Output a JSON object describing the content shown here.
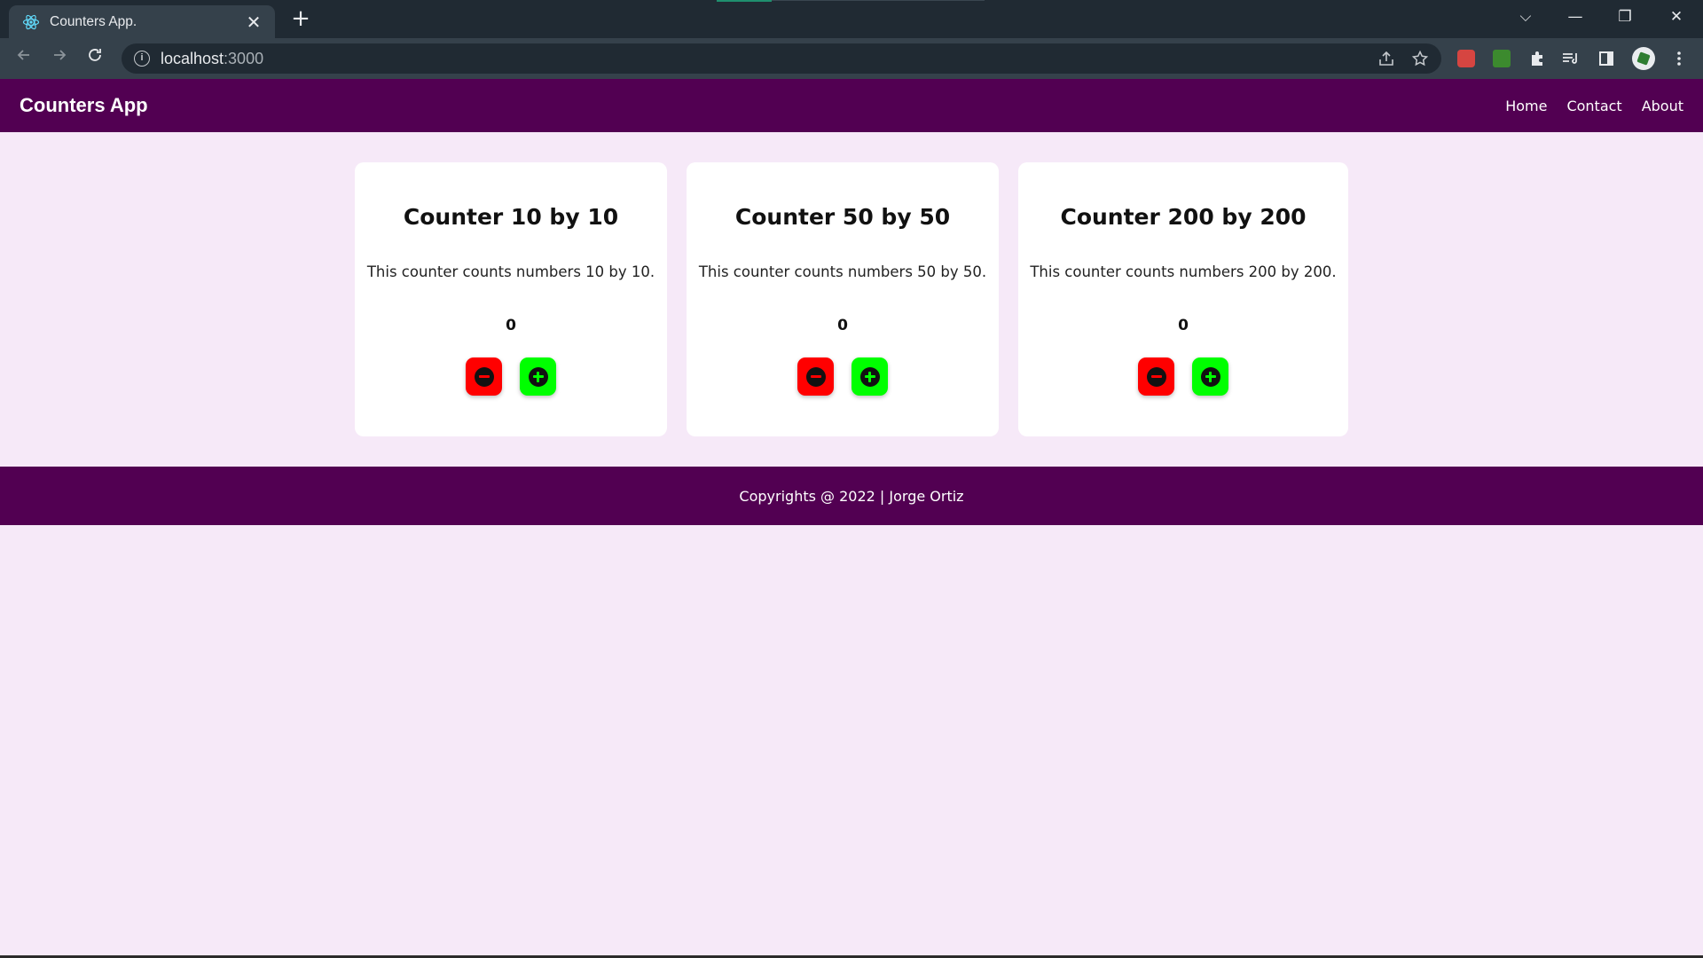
{
  "browser": {
    "tab_title": "Counters App.",
    "tab_close": "✕",
    "new_tab": "+",
    "url_host": "localhost",
    "url_port": ":3000",
    "window_controls": {
      "tab_search": "⌵",
      "minimize": "—",
      "restore": "❐",
      "close": "✕"
    },
    "icons": [
      "back-arrow-icon",
      "forward-arrow-icon",
      "reload-icon",
      "info-icon",
      "share-icon",
      "star-icon",
      "puzzle-icon",
      "media-icon",
      "side-panel-icon",
      "kebab-menu-icon"
    ]
  },
  "app": {
    "brand": "Counters App",
    "nav": {
      "home": "Home",
      "contact": "Contact",
      "about": "About"
    },
    "counters": [
      {
        "title": "Counter 10 by 10",
        "description": "This counter counts numbers 10 by 10.",
        "value": "0"
      },
      {
        "title": "Counter 50 by 50",
        "description": "This counter counts numbers 50 by 50.",
        "value": "0"
      },
      {
        "title": "Counter 200 by 200",
        "description": "This counter counts numbers 200 by 200.",
        "value": "0"
      }
    ],
    "footer": "Copyrights @ 2022 | Jorge Ortiz",
    "colors": {
      "brand": "#520052",
      "background": "#f6e9f8",
      "decrement": "#ff0000",
      "increment": "#00ff00"
    }
  }
}
